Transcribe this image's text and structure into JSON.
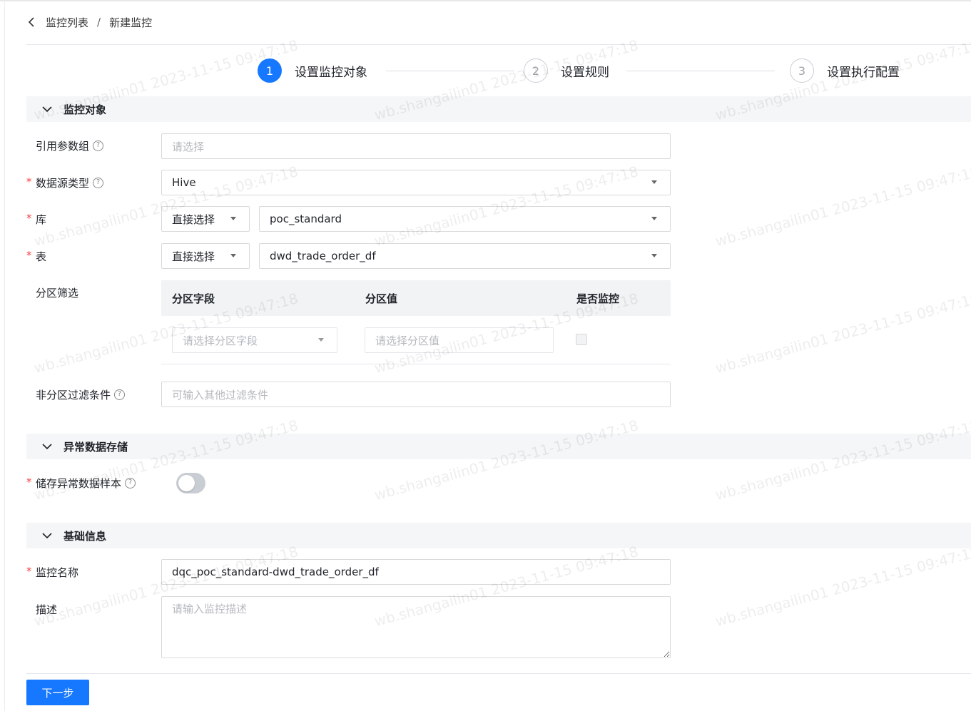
{
  "breadcrumb": {
    "parent": "监控列表",
    "separator": "/",
    "current": "新建监控"
  },
  "steps": [
    {
      "number": "1",
      "label": "设置监控对象",
      "state": "active"
    },
    {
      "number": "2",
      "label": "设置规则",
      "state": "inactive"
    },
    {
      "number": "3",
      "label": "设置执行配置",
      "state": "inactive"
    }
  ],
  "sections": {
    "monitor_object": {
      "title": "监控对象"
    },
    "abnormal_storage": {
      "title": "异常数据存储"
    },
    "basic_info": {
      "title": "基础信息"
    }
  },
  "form": {
    "param_group": {
      "label": "引用参数组",
      "placeholder": "请选择"
    },
    "datasource_type": {
      "label": "数据源类型",
      "value": "Hive"
    },
    "database": {
      "label": "库",
      "mode": "直接选择",
      "value": "poc_standard"
    },
    "table": {
      "label": "表",
      "mode": "直接选择",
      "value": "dwd_trade_order_df"
    },
    "partition": {
      "label": "分区筛选",
      "col_field": "分区字段",
      "col_value": "分区值",
      "col_monitor": "是否监控",
      "field_placeholder": "请选择分区字段",
      "value_placeholder": "请选择分区值"
    },
    "non_partition_filter": {
      "label": "非分区过滤条件",
      "placeholder": "可输入其他过滤条件"
    },
    "store_abnormal_sample": {
      "label": "储存异常数据样本",
      "enabled": false
    },
    "monitor_name": {
      "label": "监控名称",
      "value": "dqc_poc_standard-dwd_trade_order_df"
    },
    "description": {
      "label": "描述",
      "placeholder": "请输入监控描述"
    }
  },
  "required_mark": "*",
  "help_glyph": "?",
  "next_button": "下一步",
  "watermark": "wb.shangailin01 2023-11-15 09:47:18",
  "colors": {
    "primary": "#1677ff",
    "required": "#f53f3f",
    "section_bg": "#f5f6f7"
  }
}
